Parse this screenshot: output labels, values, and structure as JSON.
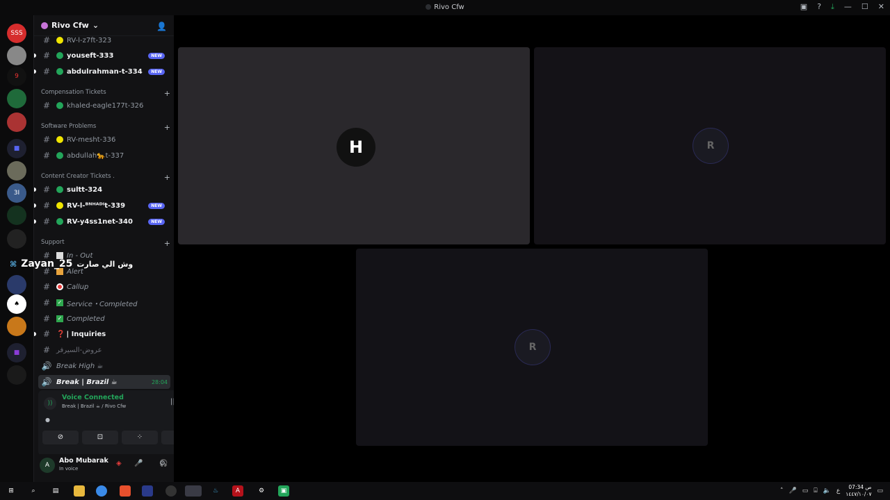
{
  "window": {
    "title": "Rivo Cfw"
  },
  "guild": {
    "name": "Rivo Cfw"
  },
  "channels": [
    {
      "name": "RV-l-z7ft-323",
      "status": "yellow",
      "badge": ""
    },
    {
      "name": "youseft-333",
      "status": "green",
      "badge": "NEW"
    },
    {
      "name": "abdulrahman-t-334",
      "status": "green",
      "badge": "NEW"
    }
  ],
  "categories": {
    "compensation": "Compensation Tickets",
    "software": "Software Problems",
    "creator": "Content Creator Tickets .",
    "support": "Support"
  },
  "comp_channels": [
    {
      "name": "khaled-eagle177t-326"
    }
  ],
  "software_channels": [
    {
      "name": "RV-mesht-336"
    },
    {
      "name": "abdullah🐆t-337"
    }
  ],
  "creator_channels": [
    {
      "name": "sultt-324",
      "badge": ""
    },
    {
      "name": "RV-l-ᴮᴺᴴᴬᴰᴵt-339",
      "badge": "NEW"
    },
    {
      "name": "RV-y4ss1net-340",
      "badge": "NEW"
    }
  ],
  "support_channels": [
    {
      "name": "In - Out"
    },
    {
      "name": "Alert"
    },
    {
      "name": "Callup"
    },
    {
      "name": "Service・Completed"
    },
    {
      "name": "Completed"
    },
    {
      "name": "| Inquiries"
    },
    {
      "name": "عروض-السيرفر"
    },
    {
      "name": "Break High ☕"
    },
    {
      "name": "Break | Brazil ☕",
      "timer": "28:04"
    }
  ],
  "overlay": {
    "username": "Zayan_25",
    "arabic": "وش الي صارت"
  },
  "voice": {
    "status": "Voice Connected",
    "channel": "Break | Brazil ☕ / Rivo Cfw"
  },
  "user": {
    "name": "Abo Mubarak",
    "status": "In voice"
  },
  "taskbar": {
    "time": "07:34 ص",
    "date": "١٤٤٧/١٠/٠٧",
    "lang": "ع"
  },
  "colors": {
    "accent": "#5865f2",
    "online": "#23a55a",
    "idle": "#f0e500"
  }
}
